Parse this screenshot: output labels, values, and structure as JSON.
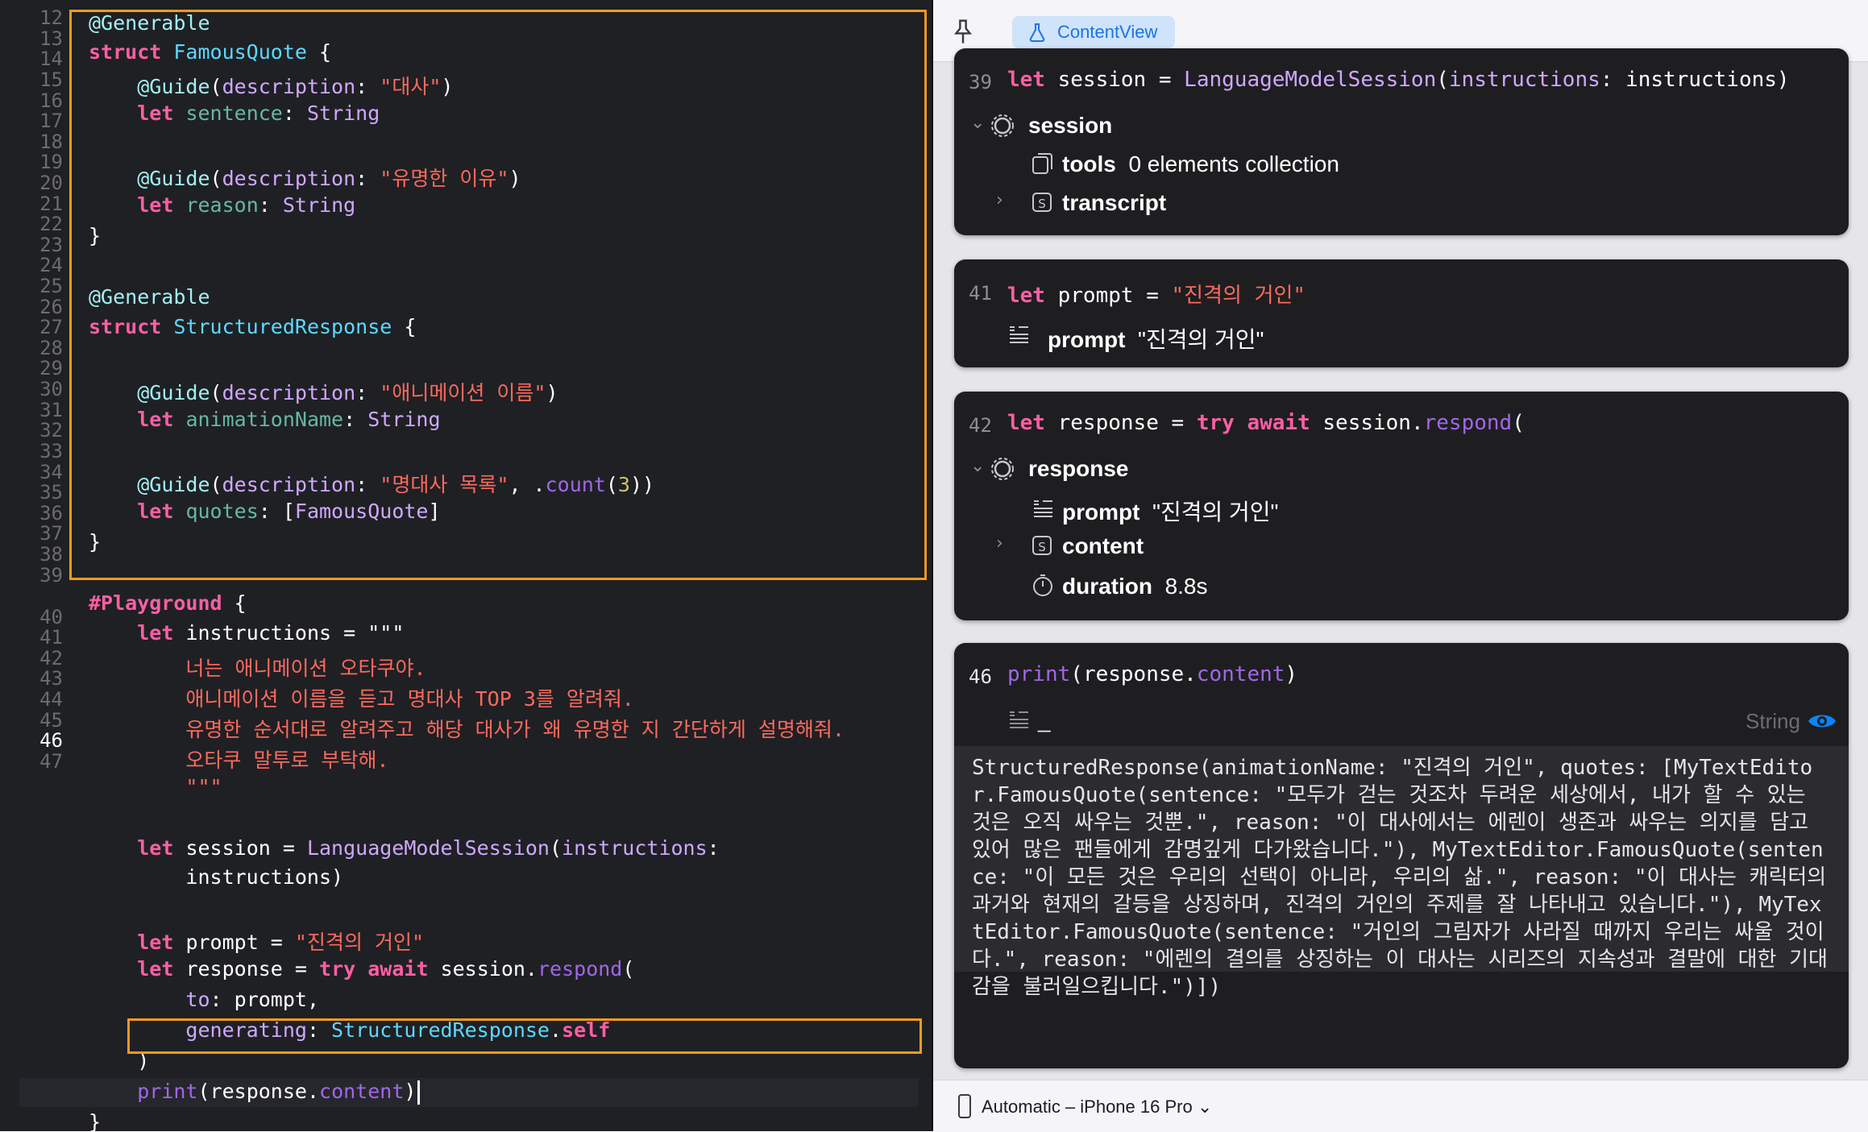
{
  "editor": {
    "line_numbers": [
      "12",
      "13",
      "14",
      "15",
      "16",
      "17",
      "18",
      "19",
      "20",
      "21",
      "22",
      "23",
      "24",
      "25",
      "26",
      "27",
      "28",
      "29",
      "30",
      "31",
      "32",
      "33",
      "34",
      "35",
      "36",
      "37",
      "38",
      "39",
      "",
      "40",
      "41",
      "42",
      "43",
      "44",
      "45",
      "46",
      "47"
    ],
    "current_line": "46",
    "code": {
      "l12": "@Generable",
      "l13_kw": "struct",
      "l13_name": "FamousQuote",
      "l13_brace": " {",
      "l14_attr": "@Guide",
      "l14_desc": "description",
      "l14_str": "\"대사\"",
      "l15_kw": "let",
      "l15_name": "sentence",
      "l15_type": "String",
      "l17_attr": "@Guide",
      "l17_desc": "description",
      "l17_str": "\"유명한 이유\"",
      "l18_kw": "let",
      "l18_name": "reason",
      "l18_type": "String",
      "l19": "}",
      "l21": "@Generable",
      "l22_kw": "struct",
      "l22_name": "StructuredResponse",
      "l22_brace": " {",
      "l24_attr": "@Guide",
      "l24_desc": "description",
      "l24_str": "\"애니메이션 이름\"",
      "l25_kw": "let",
      "l25_name": "animationName",
      "l25_type": "String",
      "l27_attr": "@Guide",
      "l27_desc": "description",
      "l27_str": "\"명대사 목록\"",
      "l27_fn": "count",
      "l27_num": "3",
      "l28_kw": "let",
      "l28_name": "quotes",
      "l28_type": "FamousQuote",
      "l29": "}",
      "l31_macro": "#Playground",
      "l31_brace": " {",
      "l32_kw": "let",
      "l32_name": "instructions",
      "l32_rest": " = \"\"\"",
      "l33": "너는 애니메이션 오타쿠야.",
      "l34": "애니메이션 이름을 듣고 명대사 TOP 3를 알려줘.",
      "l35": "유명한 순서대로 알려주고 해당 대사가 왜 유명한 지 간단하게 설명해줘.",
      "l36": "오타쿠 말투로 부탁해.",
      "l37": "\"\"\"",
      "l39_kw": "let",
      "l39_name": "session",
      "l39_type": "LanguageModelSession",
      "l39_param": "instructions",
      "l39b": "instructions)",
      "l41_kw": "let",
      "l41_name": "prompt",
      "l41_str": "\"진격의 거인\"",
      "l42_kw": "let",
      "l42_name": "response",
      "l42_try": "try",
      "l42_await": "await",
      "l42_obj": "session",
      "l42_fn": "respond",
      "l43_param": "to",
      "l43_val": "prompt,",
      "l44_param": "generating",
      "l44_type": "StructuredResponse",
      "l44_self": "self",
      "l45": ")",
      "l46_fn": "print",
      "l46_obj": "response",
      "l46_prop": "content",
      "l47": "}"
    }
  },
  "canvas": {
    "tab_label": "ContentView",
    "card1": {
      "line_no": "39",
      "code_kw": "let",
      "code_name": "session",
      "code_type": "LanguageModelSession",
      "code_param": "instructions",
      "code_val": "instructions",
      "session_label": "session",
      "tools_label": "tools",
      "tools_value": "0 elements collection",
      "transcript_label": "transcript"
    },
    "card2": {
      "line_no": "41",
      "code_kw": "let",
      "code_name": "prompt",
      "code_str": "\"진격의 거인\"",
      "prompt_label": "prompt",
      "prompt_value": "\"진격의 거인\""
    },
    "card3": {
      "line_no": "42",
      "code_kw": "let",
      "code_name": "response",
      "code_try": "try",
      "code_await": "await",
      "code_obj": "session",
      "code_fn": "respond",
      "response_label": "response",
      "prompt_label": "prompt",
      "prompt_value": "\"진격의 거인\"",
      "content_label": "content",
      "duration_label": "duration",
      "duration_value": "8.8s"
    },
    "card4": {
      "line_no": "46",
      "code_fn": "print",
      "code_obj": "response",
      "code_prop": "content",
      "type_label": "String",
      "output": "StructuredResponse(animationName: \"진격의 거인\", quotes: [MyTextEditor.FamousQuote(sentence: \"모두가 걷는 것조차 두려운 세상에서, 내가 할 수 있는 것은 오직 싸우는 것뿐.\", reason: \"이 대사에서는 에렌이 생존과 싸우는 의지를 담고 있어 많은 팬들에게 감명깊게 다가왔습니다.\"), MyTextEditor.FamousQuote(sentence: \"이 모든 것은 우리의 선택이 아니라, 우리의 삶.\", reason: \"이 대사는 캐릭터의 과거와 현재의 갈등을 상징하며, 진격의 거인의 주제를 잘 나타내고 있습니다.\"), MyTextEditor.FamousQuote(sentence: \"거인의 그림자가 사라질 때까지 우리는 싸울 것이다.\", reason: \"에렌의 결의를 상징하는 이 대사는 시리즈의 지속성과 결말에 대한 기대감을 불러일으킵니다.\")])"
    },
    "device_label": "Automatic – iPhone 16 Pro"
  },
  "colors": {
    "editor_bg": "#1f2024",
    "highlight_box": "#f29a1f",
    "keyword": "#fc5fa3",
    "string": "#fc6a5d",
    "type": "#d0a8ff",
    "accent": "#1a73e8"
  }
}
